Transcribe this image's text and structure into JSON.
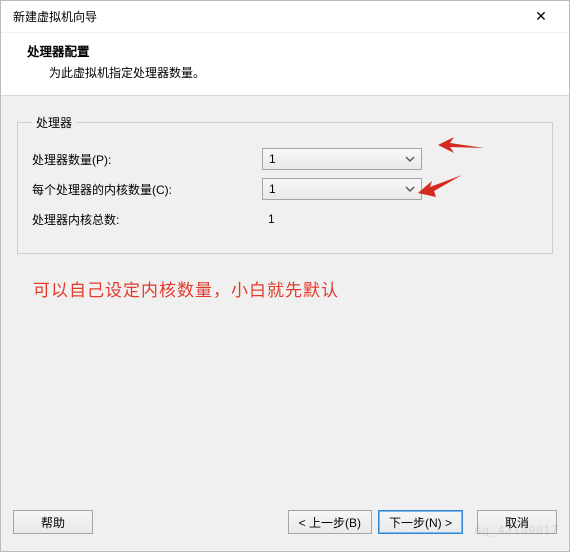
{
  "window": {
    "title": "新建虚拟机向导",
    "close_glyph": "✕"
  },
  "header": {
    "heading": "处理器配置",
    "subheading": "为此虚拟机指定处理器数量。"
  },
  "group": {
    "legend": "处理器",
    "rows": {
      "processors": {
        "label": "处理器数量(P):",
        "value": "1"
      },
      "cores": {
        "label": "每个处理器的内核数量(C):",
        "value": "1"
      },
      "total": {
        "label": "处理器内核总数:",
        "value": "1"
      }
    }
  },
  "annotation": "可以自己设定内核数量，小白就先默认",
  "footer": {
    "help": "帮助",
    "back": "< 上一步(B)",
    "next": "下一步(N) >",
    "cancel": "取消"
  },
  "watermark": "ng_43139817"
}
